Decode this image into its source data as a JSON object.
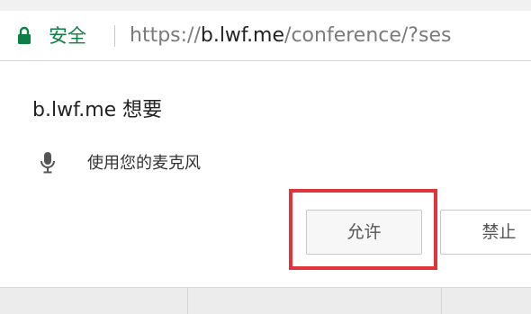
{
  "address_bar": {
    "security_label": "安全",
    "url_scheme": "https://",
    "url_host": "b.lwf.me",
    "url_path": "/conference/?ses",
    "icons": {
      "lock": "lock-icon"
    },
    "colors": {
      "secure": "#0b8043"
    }
  },
  "permission_prompt": {
    "title": "b.lwf.me 想要",
    "permission": {
      "icon": "microphone-icon",
      "text": "使用您的麦克风"
    },
    "buttons": {
      "allow_label": "允许",
      "block_label": "禁止"
    }
  },
  "annotation": {
    "highlight_color": "#e0333a"
  }
}
